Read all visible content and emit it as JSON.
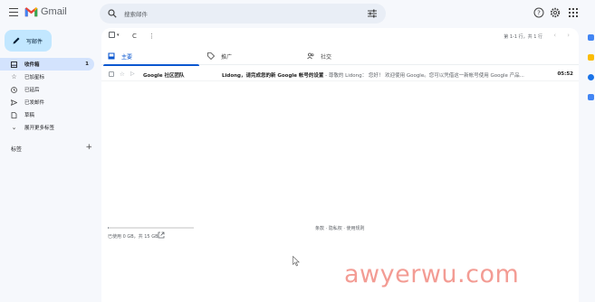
{
  "app": {
    "name": "Gmail"
  },
  "search": {
    "placeholder": "搜索邮件"
  },
  "compose": {
    "label": "写邮件"
  },
  "sidebar": {
    "items": [
      {
        "label": "收件箱",
        "count": "1"
      },
      {
        "label": "已加星标"
      },
      {
        "label": "已延后"
      },
      {
        "label": "已发邮件"
      },
      {
        "label": "草稿"
      },
      {
        "label": "展开更多标签"
      }
    ],
    "labels_header": "标签"
  },
  "toolbar": {
    "refresh": "C",
    "more": "⋮"
  },
  "pager": {
    "range": "第 1-1 行，共 1 行"
  },
  "tabs": [
    {
      "label": "主要",
      "active": true
    },
    {
      "label": "推广",
      "active": false
    },
    {
      "label": "社交",
      "active": false
    }
  ],
  "emails": [
    {
      "sender": "Google 社区团队",
      "subject": "Lidong，请完成您的新 Google 帐号的设置",
      "snippet": " - 尊敬的 Lidong： 您好！ 欢迎使用 Google。您可以凭借这一新帐号使用 Google 产品...",
      "time": "05:52"
    }
  ],
  "storage": {
    "text": "已使用 0 GB，共 15 GB",
    "used_fraction": 0.01
  },
  "footer": {
    "links": "条款 · 隐私权 · 使用规则"
  },
  "watermark": "awyerwu.com",
  "colors": {
    "accent": "#0b57d0",
    "compose_bg": "#c2e7ff",
    "active_nav": "#d3e3fd",
    "background": "#f6f8fc"
  }
}
